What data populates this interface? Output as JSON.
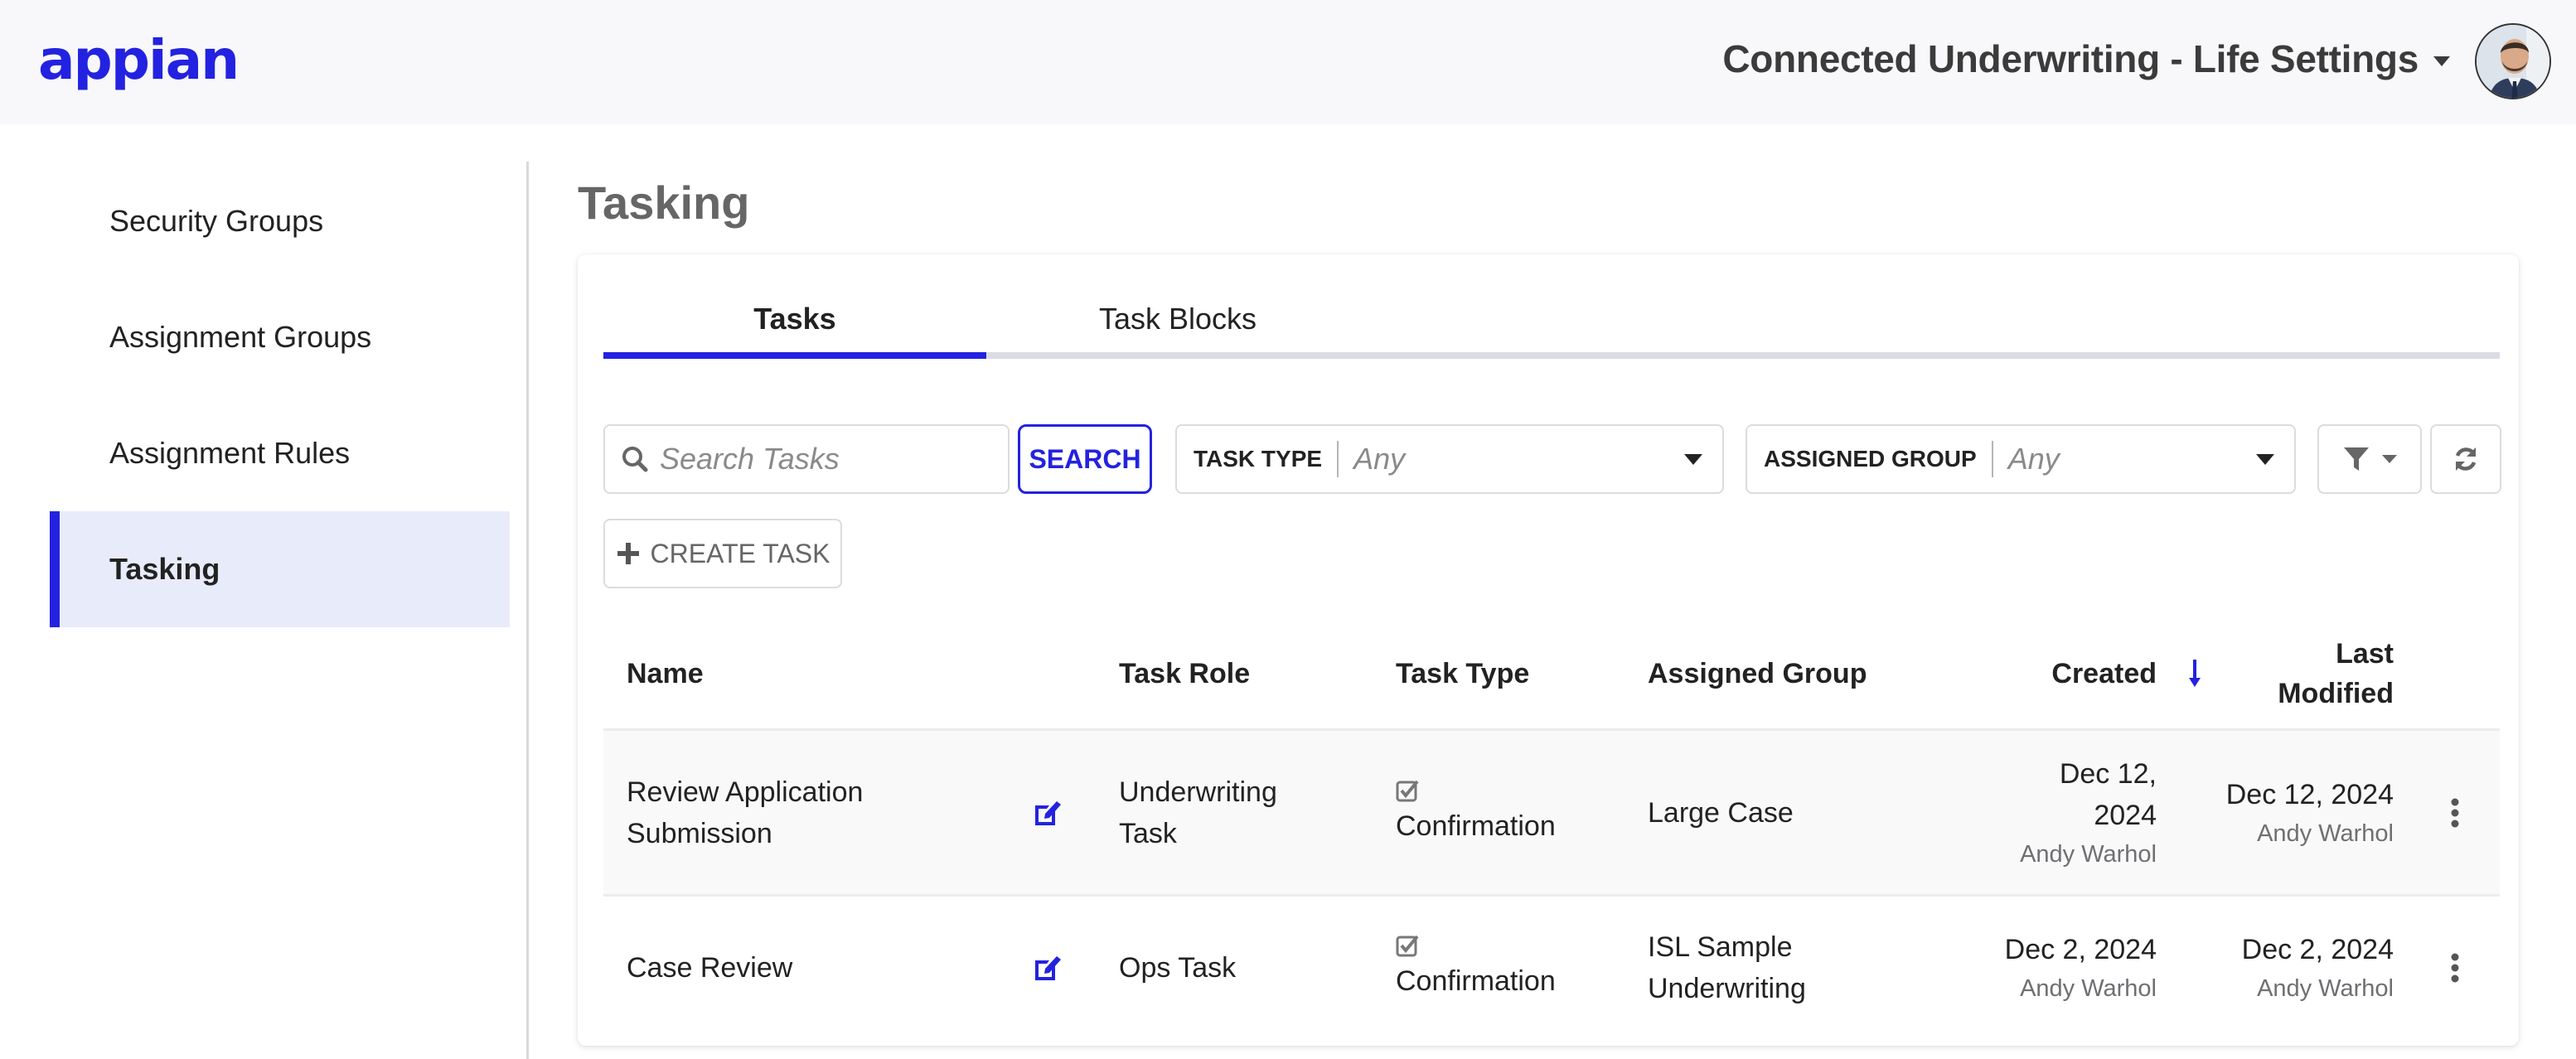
{
  "header": {
    "logo_text": "appian",
    "app_title": "Connected Underwriting - Life Settings",
    "brand_color": "#2322e0"
  },
  "sidebar": {
    "items": [
      {
        "label": "Security Groups",
        "active": false
      },
      {
        "label": "Assignment Groups",
        "active": false
      },
      {
        "label": "Assignment Rules",
        "active": false
      },
      {
        "label": "Tasking",
        "active": true
      }
    ]
  },
  "page": {
    "title": "Tasking"
  },
  "tabs": [
    {
      "label": "Tasks",
      "active": true
    },
    {
      "label": "Task Blocks",
      "active": false
    }
  ],
  "toolbar": {
    "search_placeholder": "Search Tasks",
    "search_value": "",
    "search_button": "SEARCH",
    "task_type_label": "TASK TYPE",
    "task_type_value": "Any",
    "assigned_group_label": "ASSIGNED GROUP",
    "assigned_group_value": "Any",
    "create_button": "CREATE TASK",
    "icons": {
      "search": "search-icon",
      "filter": "filter-icon",
      "refresh": "refresh-icon",
      "plus": "plus-icon"
    }
  },
  "table": {
    "columns": [
      "Name",
      "Task Role",
      "Task Type",
      "Assigned Group",
      "Created",
      "Last Modified"
    ],
    "last_modified_lines": [
      "Last",
      "Modified"
    ],
    "sort": {
      "column": "Created",
      "direction": "descending"
    },
    "rows": [
      {
        "name_lines": [
          "Review Application",
          "Submission"
        ],
        "name": "Review Application Submission",
        "task_role_lines": [
          "Underwriting",
          "Task"
        ],
        "task_type": "Confirmation",
        "assigned_group_lines": [
          "Large Case"
        ],
        "created_lines": [
          "Dec 12,",
          "2024"
        ],
        "created_by": "Andy Warhol",
        "modified": "Dec 12, 2024",
        "modified_by": "Andy Warhol"
      },
      {
        "name_lines": [
          "Case Review"
        ],
        "name": "Case Review",
        "task_role_lines": [
          "Ops Task"
        ],
        "task_type": "Confirmation",
        "assigned_group_lines": [
          "ISL Sample",
          "Underwriting"
        ],
        "created_lines": [
          "Dec 2, 2024"
        ],
        "created_by": "Andy Warhol",
        "modified": "Dec 2, 2024",
        "modified_by": "Andy Warhol"
      }
    ]
  }
}
